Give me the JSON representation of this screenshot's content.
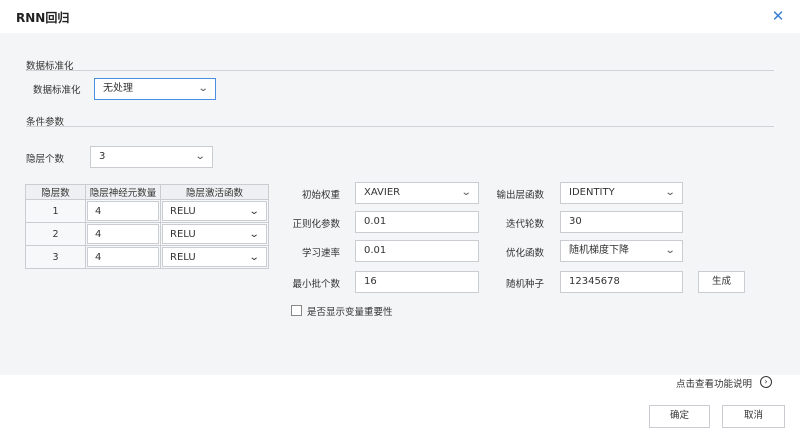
{
  "dialog": {
    "title": "RNN回归",
    "close_icon": "close-icon"
  },
  "normalization": {
    "section_title": "数据标准化",
    "label": "数据标准化",
    "value": "无处理"
  },
  "conditions": {
    "section_title": "条件参数",
    "hidden_layers_label": "隐层个数",
    "hidden_layers_value": "3"
  },
  "layer_table": {
    "headers": [
      "隐层数",
      "隐层神经元数量",
      "隐层激活函数"
    ],
    "rows": [
      {
        "index": "1",
        "neurons": "4",
        "activation": "RELU"
      },
      {
        "index": "2",
        "neurons": "4",
        "activation": "RELU"
      },
      {
        "index": "3",
        "neurons": "4",
        "activation": "RELU"
      }
    ]
  },
  "params": {
    "init_weight": {
      "label": "初始权重",
      "value": "XAVIER"
    },
    "output_func": {
      "label": "输出层函数",
      "value": "IDENTITY"
    },
    "regularization": {
      "label": "正则化参数",
      "value": "0.01"
    },
    "iterations": {
      "label": "迭代轮数",
      "value": "30"
    },
    "learning_rate": {
      "label": "学习速率",
      "value": "0.01"
    },
    "optimizer": {
      "label": "优化函数",
      "value": "随机梯度下降"
    },
    "min_batch": {
      "label": "最小批个数",
      "value": "16"
    },
    "random_seed": {
      "label": "随机种子",
      "value": "12345678"
    },
    "generate_label": "生成",
    "show_importance_label": "是否显示变量重要性"
  },
  "footer": {
    "help_link": "点击查看功能说明",
    "confirm_label": "确定",
    "cancel_label": "取消"
  },
  "colors": {
    "accent": "#3b7fd4",
    "content_bg": "#f4f5f7",
    "border": "#c9ccd1"
  }
}
